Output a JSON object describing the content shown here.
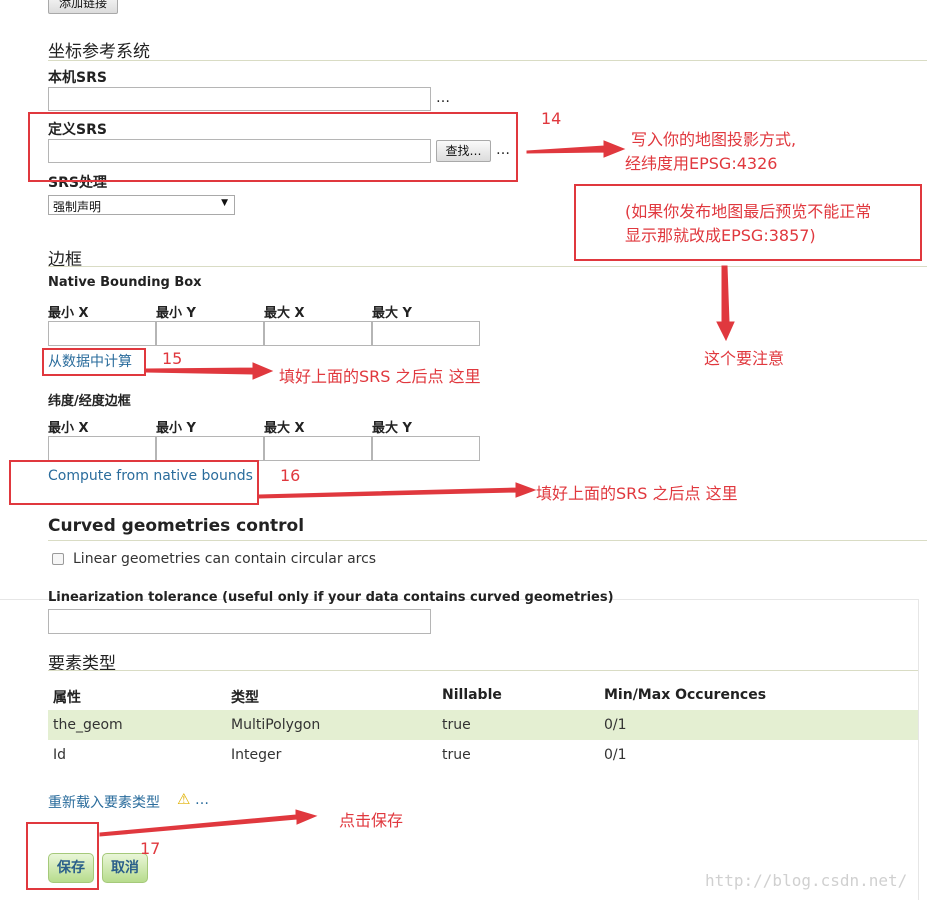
{
  "top": {
    "add_link_button": "添加链接"
  },
  "crs": {
    "title": "坐标参考系统",
    "native_srs_label": "本机SRS",
    "native_srs_value": "",
    "native_srs_more": "…",
    "declared_srs_label": "定义SRS",
    "declared_srs_value": "",
    "find_button": "查找…",
    "declared_srs_more": "…",
    "srs_handling_label": "SRS处理",
    "srs_handling_value": "强制声明"
  },
  "bbox": {
    "title": "边框",
    "native_label": "Native Bounding Box",
    "min_x": "最小 X",
    "min_y": "最小 Y",
    "max_x": "最大 X",
    "max_y": "最大 Y",
    "compute_from_data": "从数据中计算",
    "latlon_label": "纬度/经度边框",
    "compute_from_native": "Compute from native bounds"
  },
  "curved": {
    "title": "Curved geometries control",
    "checkbox_label": "Linear geometries can contain circular arcs",
    "checked": false,
    "tolerance_label": "Linearization tolerance (useful only if your data contains curved geometries)",
    "tolerance_value": ""
  },
  "feature_type": {
    "title": "要素类型",
    "columns": [
      "属性",
      "类型",
      "Nillable",
      "Min/Max Occurences"
    ],
    "rows": [
      [
        "the_geom",
        "MultiPolygon",
        "true",
        "0/1"
      ],
      [
        "Id",
        "Integer",
        "true",
        "0/1"
      ]
    ],
    "reload_link": "重新载入要素类型",
    "reload_more": "…"
  },
  "actions": {
    "save": "保存",
    "cancel": "取消"
  },
  "annotations": {
    "num14": "14",
    "note14_line1": "写入你的地图投影方式,",
    "note14_line2": "经纬度用EPSG:4326",
    "note_box_line1": "(如果你发布地图最后预览不能正常",
    "note_box_line2": "显示那就改成EPSG:3857)",
    "attention": "这个要注意",
    "num15": "15",
    "note15": "填好上面的SRS 之后点 这里",
    "num16": "16",
    "note16": "填好上面的SRS 之后点 这里",
    "click_save": "点击保存",
    "num17": "17"
  },
  "watermark": "http://blog.csdn.net/",
  "colors": {
    "annotation_red": "#e0383e",
    "link_blue": "#2a6c9c",
    "row_highlight": "#e4efd2",
    "button_green": "#b7dc8d"
  }
}
